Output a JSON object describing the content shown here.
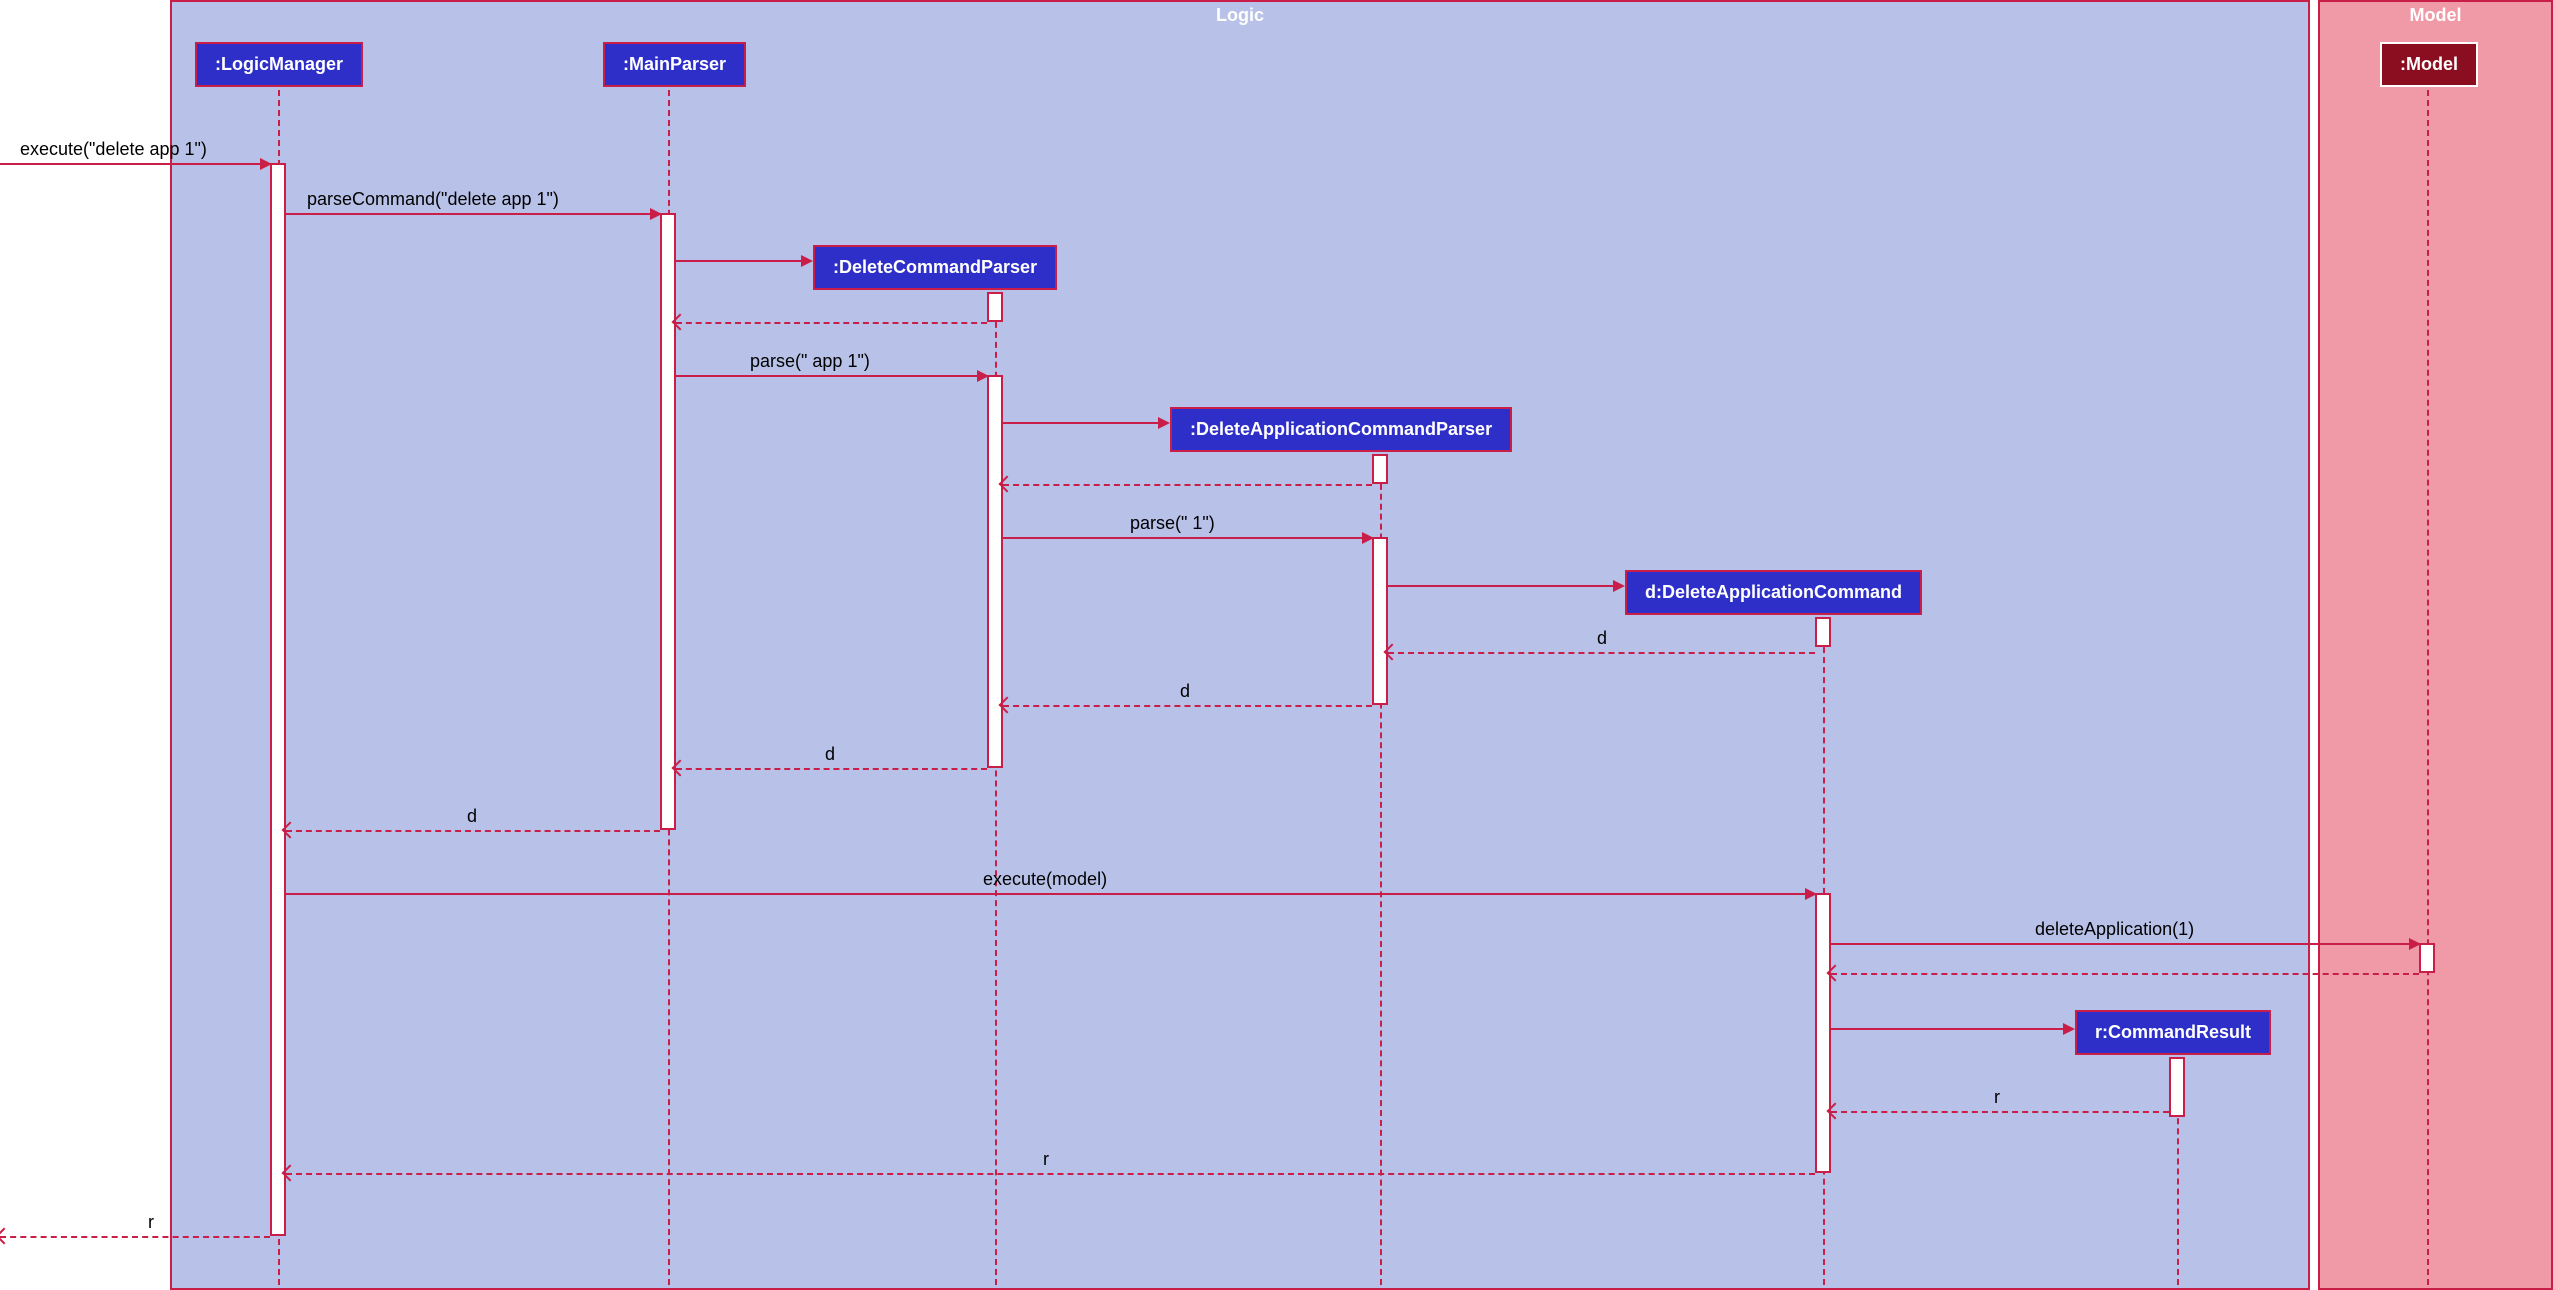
{
  "frames": {
    "logic": "Logic",
    "model": "Model"
  },
  "participants": {
    "logicManager": ":LogicManager",
    "mainParser": ":MainParser",
    "deleteCommandParser": ":DeleteCommandParser",
    "deleteAppCommandParser": ":DeleteApplicationCommandParser",
    "deleteAppCommand": "d:DeleteApplicationCommand",
    "commandResult": "r:CommandResult",
    "model": ":Model"
  },
  "messages": {
    "execute_in": "execute(\"delete app 1\")",
    "parseCommand": "parseCommand(\"delete app 1\")",
    "parseApp": "parse(\" app 1\")",
    "parse1": "parse(\" 1\")",
    "d": "d",
    "executeModel": "execute(model)",
    "deleteApplication": "deleteApplication(1)",
    "r": "r"
  }
}
